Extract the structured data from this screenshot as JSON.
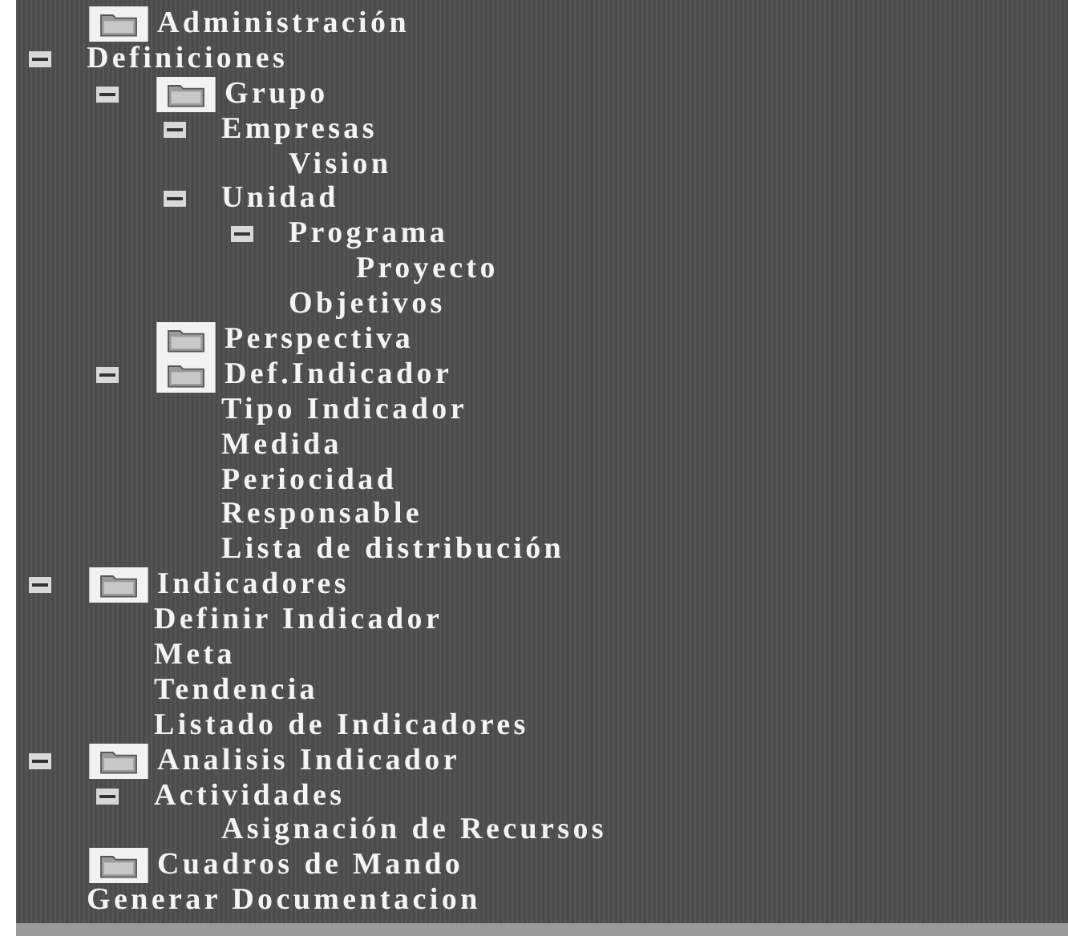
{
  "tree": [
    {
      "label": "Administración",
      "kind": "folder"
    },
    {
      "label": "Definiciones",
      "kind": "item",
      "expanded": true,
      "children": [
        {
          "label": "Grupo",
          "kind": "folder",
          "expanded": true,
          "children": [
            {
              "label": "Empresas",
              "kind": "item",
              "expanded": true,
              "children": [
                {
                  "label": "Vision",
                  "kind": "item"
                }
              ]
            },
            {
              "label": "Unidad",
              "kind": "item",
              "expanded": true,
              "children": [
                {
                  "label": "Programa",
                  "kind": "item",
                  "expanded": true,
                  "children": [
                    {
                      "label": "Proyecto",
                      "kind": "item"
                    }
                  ]
                },
                {
                  "label": "Objetivos",
                  "kind": "item"
                }
              ]
            }
          ]
        },
        {
          "label": "Perspectiva",
          "kind": "folder"
        },
        {
          "label": "Def.Indicador",
          "kind": "folder",
          "expanded": true,
          "children": [
            {
              "label": "Tipo Indicador",
              "kind": "item"
            },
            {
              "label": "Medida",
              "kind": "item"
            },
            {
              "label": "Periocidad",
              "kind": "item"
            },
            {
              "label": "Responsable",
              "kind": "item"
            },
            {
              "label": "Lista de distribución",
              "kind": "item"
            }
          ]
        }
      ]
    },
    {
      "label": "Indicadores",
      "kind": "folder",
      "expanded": true,
      "children": [
        {
          "label": "Definir Indicador",
          "kind": "item"
        },
        {
          "label": "Meta",
          "kind": "item"
        },
        {
          "label": "Tendencia",
          "kind": "item"
        },
        {
          "label": "Listado de Indicadores",
          "kind": "item"
        }
      ]
    },
    {
      "label": "Analisis Indicador",
      "kind": "folder",
      "expanded": true,
      "children": [
        {
          "label": "Actividades",
          "kind": "item",
          "expanded": true,
          "children": [
            {
              "label": "Asignación de Recursos",
              "kind": "item"
            }
          ]
        }
      ]
    },
    {
      "label": "Cuadros de Mando",
      "kind": "folder"
    },
    {
      "label": "Generar Documentacion",
      "kind": "item"
    }
  ]
}
